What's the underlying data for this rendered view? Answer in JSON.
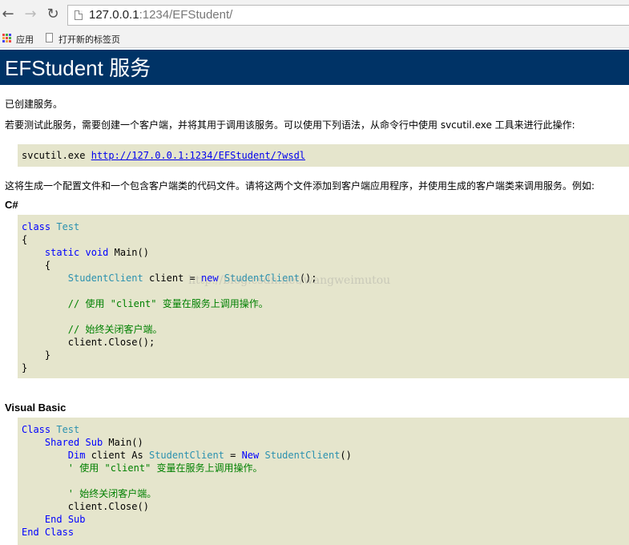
{
  "browser": {
    "address_host": "127.0.0.1",
    "address_rest": ":1234/EFStudent/",
    "bookmarks": [
      "应用",
      "打开新的标签页"
    ]
  },
  "page": {
    "title": "EFStudent 服务",
    "intro": "已创建服务。",
    "instruction": "若要测试此服务，需要创建一个客户端，并将其用于调用该服务。可以使用下列语法，从命令行中使用 svcutil.exe 工具来进行此操作:",
    "svcutil_cmd": "svcutil.exe",
    "wsdl_link": "http://127.0.0.1:1234/EFStudent/?wsdl",
    "generate_text": "这将生成一个配置文件和一个包含客户端类的代码文件。请将这两个文件添加到客户端应用程序，并使用生成的客户端类来调用服务。例如:",
    "csharp_heading": "C#",
    "vb_heading": "Visual Basic",
    "watermark": "http://blog.csdn.net/wangweimutou"
  },
  "csharp_code": [
    [
      [
        "kw",
        "class"
      ],
      [
        "tx",
        " "
      ],
      [
        "ty",
        "Test"
      ]
    ],
    [
      [
        "tx",
        "{"
      ]
    ],
    [
      [
        "tx",
        "    "
      ],
      [
        "kw",
        "static"
      ],
      [
        "tx",
        " "
      ],
      [
        "kw",
        "void"
      ],
      [
        "tx",
        " Main()"
      ]
    ],
    [
      [
        "tx",
        "    {"
      ]
    ],
    [
      [
        "tx",
        "        "
      ],
      [
        "ty",
        "StudentClient"
      ],
      [
        "tx",
        " client = "
      ],
      [
        "kw",
        "new"
      ],
      [
        "tx",
        " "
      ],
      [
        "ty",
        "StudentClient"
      ],
      [
        "tx",
        "();"
      ]
    ],
    [],
    [
      [
        "tx",
        "        "
      ],
      [
        "cm",
        "// 使用 \"client\" 变量在服务上调用操作。"
      ]
    ],
    [],
    [
      [
        "tx",
        "        "
      ],
      [
        "cm",
        "// 始终关闭客户端。"
      ]
    ],
    [
      [
        "tx",
        "        client.Close();"
      ]
    ],
    [
      [
        "tx",
        "    }"
      ]
    ],
    [
      [
        "tx",
        "}"
      ]
    ]
  ],
  "vb_code": [
    [
      [
        "kw",
        "Class"
      ],
      [
        "tx",
        " "
      ],
      [
        "ty",
        "Test"
      ]
    ],
    [
      [
        "tx",
        "    "
      ],
      [
        "kw",
        "Shared"
      ],
      [
        "tx",
        " "
      ],
      [
        "kw",
        "Sub"
      ],
      [
        "tx",
        " Main()"
      ]
    ],
    [
      [
        "tx",
        "        "
      ],
      [
        "kw",
        "Dim"
      ],
      [
        "tx",
        " client As "
      ],
      [
        "ty",
        "StudentClient"
      ],
      [
        "tx",
        " = "
      ],
      [
        "kw",
        "New"
      ],
      [
        "tx",
        " "
      ],
      [
        "ty",
        "StudentClient"
      ],
      [
        "tx",
        "()"
      ]
    ],
    [
      [
        "tx",
        "        "
      ],
      [
        "cm",
        "' 使用 \"client\" 变量在服务上调用操作。"
      ]
    ],
    [],
    [
      [
        "tx",
        "        "
      ],
      [
        "cm",
        "' 始终关闭客户端。"
      ]
    ],
    [
      [
        "tx",
        "        client.Close()"
      ]
    ],
    [
      [
        "tx",
        "    "
      ],
      [
        "kw",
        "End"
      ],
      [
        "tx",
        " "
      ],
      [
        "kw",
        "Sub"
      ]
    ],
    [
      [
        "kw",
        "End"
      ],
      [
        "tx",
        " "
      ],
      [
        "kw",
        "Class"
      ]
    ]
  ],
  "colors": {
    "header_bg": "#003366",
    "code_bg": "#e5e5cc",
    "keyword": "#0000ff",
    "type": "#2b91af",
    "comment": "#008000"
  },
  "icons": [
    "back-arrow-icon",
    "forward-arrow-icon",
    "reload-icon",
    "page-icon",
    "apps-grid-icon"
  ]
}
